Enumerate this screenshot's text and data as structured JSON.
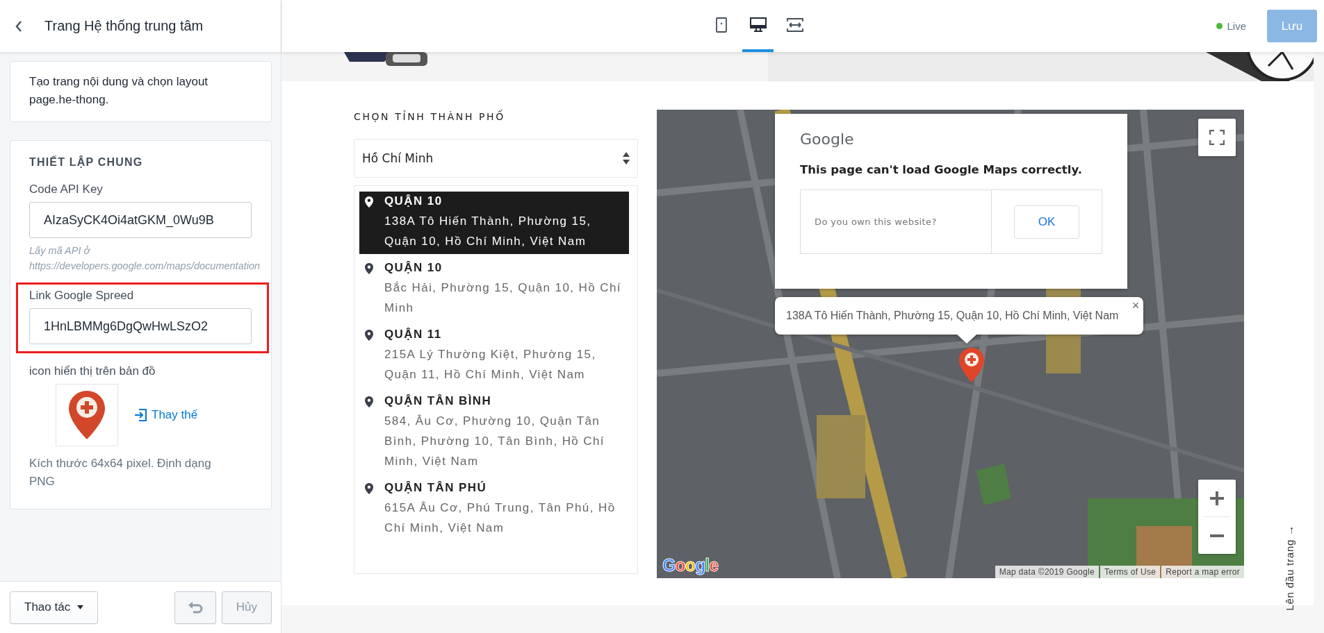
{
  "sidebar": {
    "title": "Trang Hệ thống trung tâm",
    "description": "Tạo trang nội dung và chọn layout page.he-thong.",
    "section": {
      "heading": "THIẾT LẬP CHUNG",
      "fields": [
        {
          "label": "Code API Key",
          "value": "AIzaSyCK4Oi4atGKM_0Wu9B",
          "highlighted": false,
          "hint": "Lấy mã API ở",
          "hint_url": "https://developers.google.com/maps/documentation"
        },
        {
          "label": "Link Google Spreed",
          "value": "1HnLBMMg6DgQwHwLSzO2",
          "highlighted": true
        }
      ],
      "icon_label": "icon hiển thị trên bản đồ",
      "replace_link": "Thay thế",
      "size_note": "Kích thước 64x64 pixel. Định dạng PNG"
    },
    "footer": {
      "actions_button": "Thao tác",
      "undo_disabled": true,
      "cancel_button": "Hủy",
      "cancel_disabled": true
    }
  },
  "topbar": {
    "devices": [
      {
        "kind": "tablet",
        "selected": false
      },
      {
        "kind": "desktop",
        "selected": true
      },
      {
        "kind": "fullwidth",
        "selected": false
      }
    ],
    "status": "Live",
    "save_button": "Lưu"
  },
  "content": {
    "heading": "CHỌN TỈNH THÀNH PHỐ",
    "city_select": {
      "value": "Hồ Chí Minh"
    },
    "locations": [
      {
        "name": "QUẬN 10",
        "address": "138A Tô Hiến Thành, Phường 15, Quận 10, Hồ Chí Minh, Việt Nam",
        "selected": true
      },
      {
        "name": "QUẬN 10",
        "address": "Bắc Hải, Phường 15, Quận 10, Hồ Chí Minh",
        "selected": false
      },
      {
        "name": "QUẬN 11",
        "address": "215A Lý Thường Kiệt, Phường 15, Quận 11, Hồ Chí Minh, Việt Nam",
        "selected": false
      },
      {
        "name": "QUẬN TÂN BÌNH",
        "address": "584, Âu Cơ, Phường 10, Quận Tân Bình, Phường 10, Tân Bình, Hồ Chí Minh, Việt Nam",
        "selected": false
      },
      {
        "name": "QUẬN TÂN PHÚ",
        "address": "615A Âu Cơ, Phú Trung, Tân Phú, Hồ Chí Minh, Việt Nam",
        "selected": false
      }
    ],
    "map": {
      "dialog": {
        "brand": "Google",
        "message": "This page can't load Google Maps correctly.",
        "question": "Do you own this website?",
        "ok_button": "OK"
      },
      "info_window": {
        "text": "138A Tô Hiến Thành, Phường 15, Quận 10, Hồ Chí Minh, Việt Nam",
        "close": "×"
      },
      "logo": "Google",
      "attribution": [
        "Map data ©2019 Google",
        "Terms of Use",
        "Report a map error"
      ]
    },
    "back_to_top": "Lên đầu trang →"
  }
}
